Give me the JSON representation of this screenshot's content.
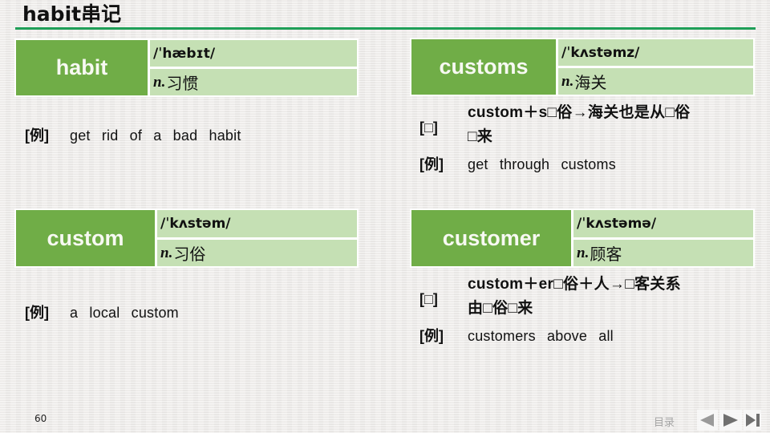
{
  "page": {
    "title": "habit串记",
    "page_number": "60"
  },
  "colors": {
    "headword_bg": "#70ad47",
    "cell_bg": "#c5e0b4",
    "rule": "#1f9f58"
  },
  "cards": [
    {
      "word": "habit",
      "phonetic": "/ˈhæbɪt/",
      "pos": "n.",
      "meaning": "习惯",
      "example": {
        "tag": "[例]",
        "text": "get rid of a bad habit"
      }
    },
    {
      "word": "customs",
      "phonetic": "/ˈkʌstəmz/",
      "pos": "n.",
      "meaning": "海关",
      "etymology": {
        "tag": "[□]",
        "line1": "custom＋s□俗→海关也是从□俗",
        "line2": "□来"
      },
      "example": {
        "tag": "[例]",
        "text": "get through customs"
      }
    },
    {
      "word": "custom",
      "phonetic": "/ˈkʌstəm/",
      "pos": "n.",
      "meaning": "习俗",
      "example": {
        "tag": "[例]",
        "text": "a local custom"
      }
    },
    {
      "word": "customer",
      "phonetic": "/ˈkʌstəmə/",
      "pos": "n.",
      "meaning": "顾客",
      "etymology": {
        "tag": "[□]",
        "line1": "custom＋er□俗＋人→□客关系",
        "line2": "由□俗□来"
      },
      "example": {
        "tag": "[例]",
        "text": "customers above all"
      }
    }
  ],
  "footer": {
    "toc_label": "目录",
    "nav": [
      {
        "action": "previous",
        "icon": "triangle-left-icon"
      },
      {
        "action": "next",
        "icon": "triangle-right-icon"
      },
      {
        "action": "last",
        "icon": "skip-to-end-icon"
      }
    ]
  }
}
